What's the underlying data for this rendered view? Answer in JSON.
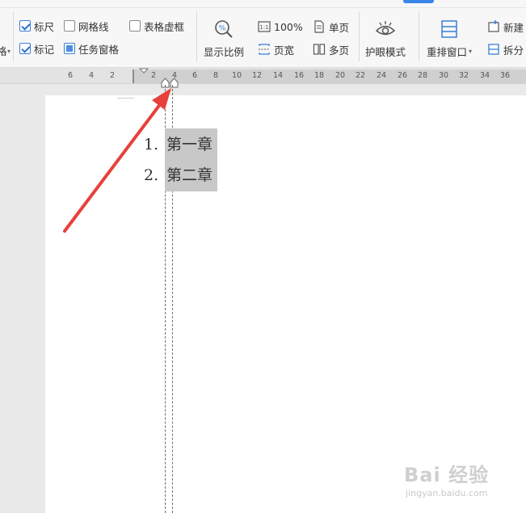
{
  "ribbon": {
    "left_group": {
      "partial_label": "格",
      "checkboxes": [
        {
          "label": "标尺",
          "checked": true
        },
        {
          "label": "网格线",
          "checked": false
        },
        {
          "label": "表格虚框",
          "checked": false
        },
        {
          "label": "标记",
          "checked": true
        },
        {
          "label": "任务窗格",
          "checked": true
        }
      ]
    },
    "zoom_group": {
      "zoom_button": "显示比例",
      "zoom_100": "100%",
      "page_width": "页宽",
      "single_page": "单页",
      "multi_page": "多页"
    },
    "eye_protect": "护眼模式",
    "window_group": {
      "arrange": "重排窗口",
      "new_window": "新建",
      "split": "拆分"
    }
  },
  "ruler": {
    "labels": [
      "6",
      "4",
      "2",
      "2",
      "4",
      "6",
      "8",
      "10",
      "12",
      "14",
      "16",
      "18",
      "20",
      "22",
      "24",
      "26",
      "28",
      "30",
      "32",
      "34",
      "36"
    ]
  },
  "document": {
    "list": [
      {
        "number": "1.",
        "text": "第一章"
      },
      {
        "number": "2.",
        "text": "第二章"
      }
    ]
  },
  "watermark": {
    "main": "Bai 经验",
    "sub": "jingyan.baidu.com"
  },
  "colors": {
    "arrow": "#e8403a",
    "accent": "#3a86e8",
    "selection": "#c8c8c8"
  }
}
